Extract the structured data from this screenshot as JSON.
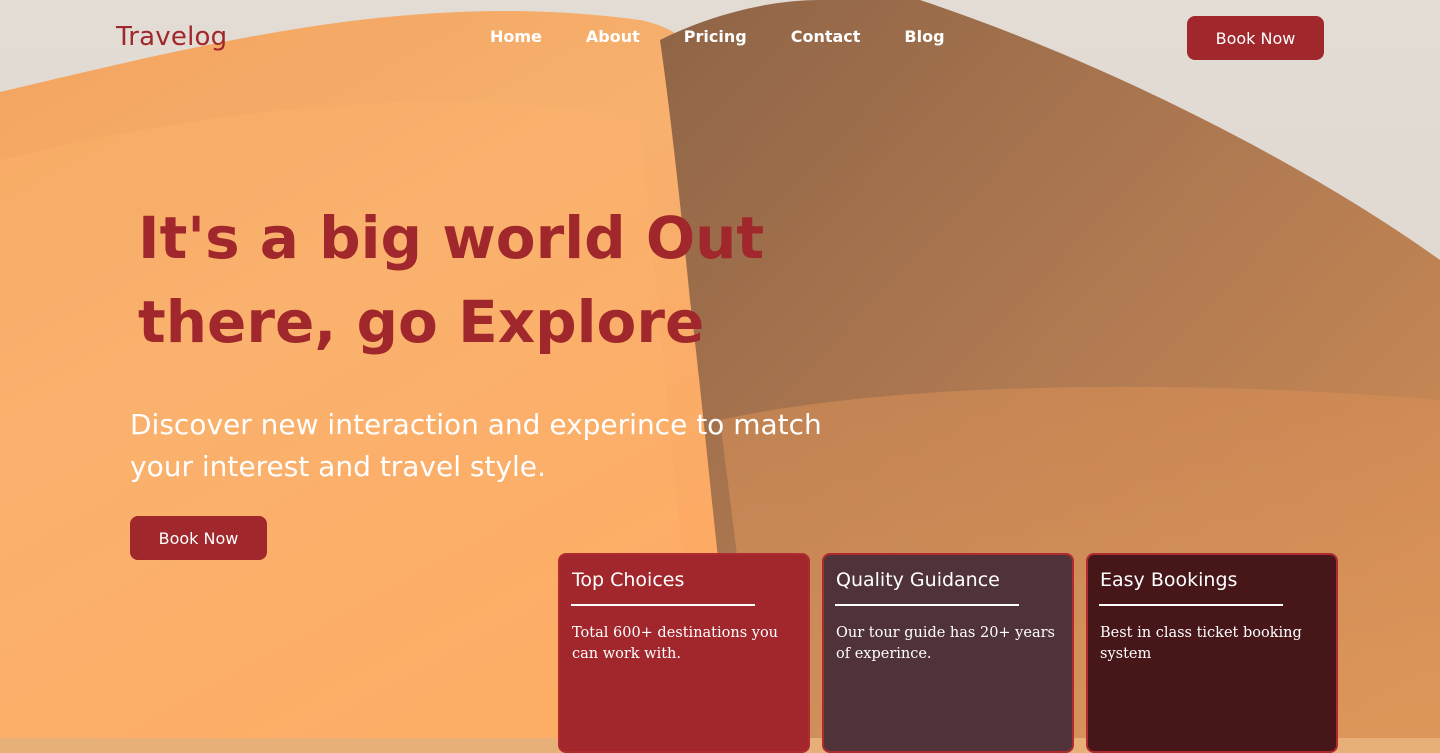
{
  "header": {
    "logo": "Travelog",
    "nav": [
      "Home",
      "About",
      "Pricing",
      "Contact",
      "Blog"
    ],
    "cta_label": "Book Now"
  },
  "hero": {
    "title": "It's a big world Out there, go Explore",
    "subtitle": "Discover new interaction and experince to match your interest and travel style.",
    "cta_label": "Book Now"
  },
  "features": [
    {
      "title": "Top Choices",
      "text": "Total 600+ destinations you can work with."
    },
    {
      "title": "Quality Guidance",
      "text": "Our tour guide has 20+ years of experince."
    },
    {
      "title": "Easy Bookings",
      "text": "Best in class ticket booking system"
    }
  ],
  "colors": {
    "brand": "#a0272c",
    "card_1": "#a1272c",
    "card_2": "#503338",
    "card_3": "#461619",
    "text_light": "#ffffff"
  }
}
